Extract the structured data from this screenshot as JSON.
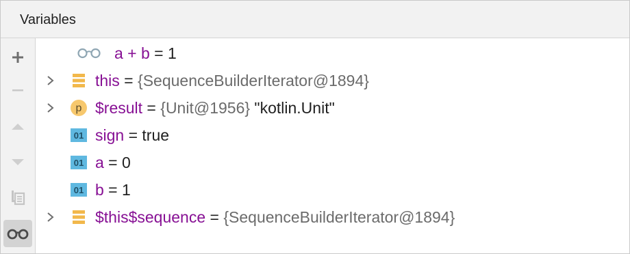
{
  "header": {
    "title": "Variables"
  },
  "toolbar": {
    "buttons": [
      {
        "name": "add-watch",
        "icon": "plus-icon"
      },
      {
        "name": "remove-watch",
        "icon": "minus-icon"
      },
      {
        "name": "move-up",
        "icon": "triangle-up-icon"
      },
      {
        "name": "move-down",
        "icon": "triangle-down-icon"
      },
      {
        "name": "duplicate-watch",
        "icon": "copy-icon"
      },
      {
        "name": "show-watches",
        "icon": "glasses-icon"
      }
    ]
  },
  "tree": {
    "rows": [
      {
        "kind": "watch",
        "name": "a + b",
        "sep": " = ",
        "value": "1"
      },
      {
        "kind": "object",
        "name": "this",
        "sep": " = ",
        "value": "{SequenceBuilderIterator@1894}",
        "expandable": true
      },
      {
        "kind": "param",
        "icon_letter": "p",
        "name": "$result",
        "sep": " = ",
        "value": "{Unit@1956}",
        "extra": " \"kotlin.Unit\"",
        "expandable": true
      },
      {
        "kind": "primitive",
        "icon_text": "01",
        "name": "sign",
        "sep": " = ",
        "value": "true"
      },
      {
        "kind": "primitive",
        "icon_text": "01",
        "name": "a",
        "sep": " = ",
        "value": "0"
      },
      {
        "kind": "primitive",
        "icon_text": "01",
        "name": "b",
        "sep": " = ",
        "value": "1"
      },
      {
        "kind": "object",
        "name": "$this$sequence",
        "sep": " = ",
        "value": "{SequenceBuilderIterator@1894}",
        "expandable": true
      }
    ]
  },
  "colors": {
    "variable_name": "#871094",
    "object_value": "#6b6b6b",
    "field_icon": "#f2b84b",
    "param_icon": "#f7c86d",
    "primitive_icon": "#5fb8e0"
  }
}
